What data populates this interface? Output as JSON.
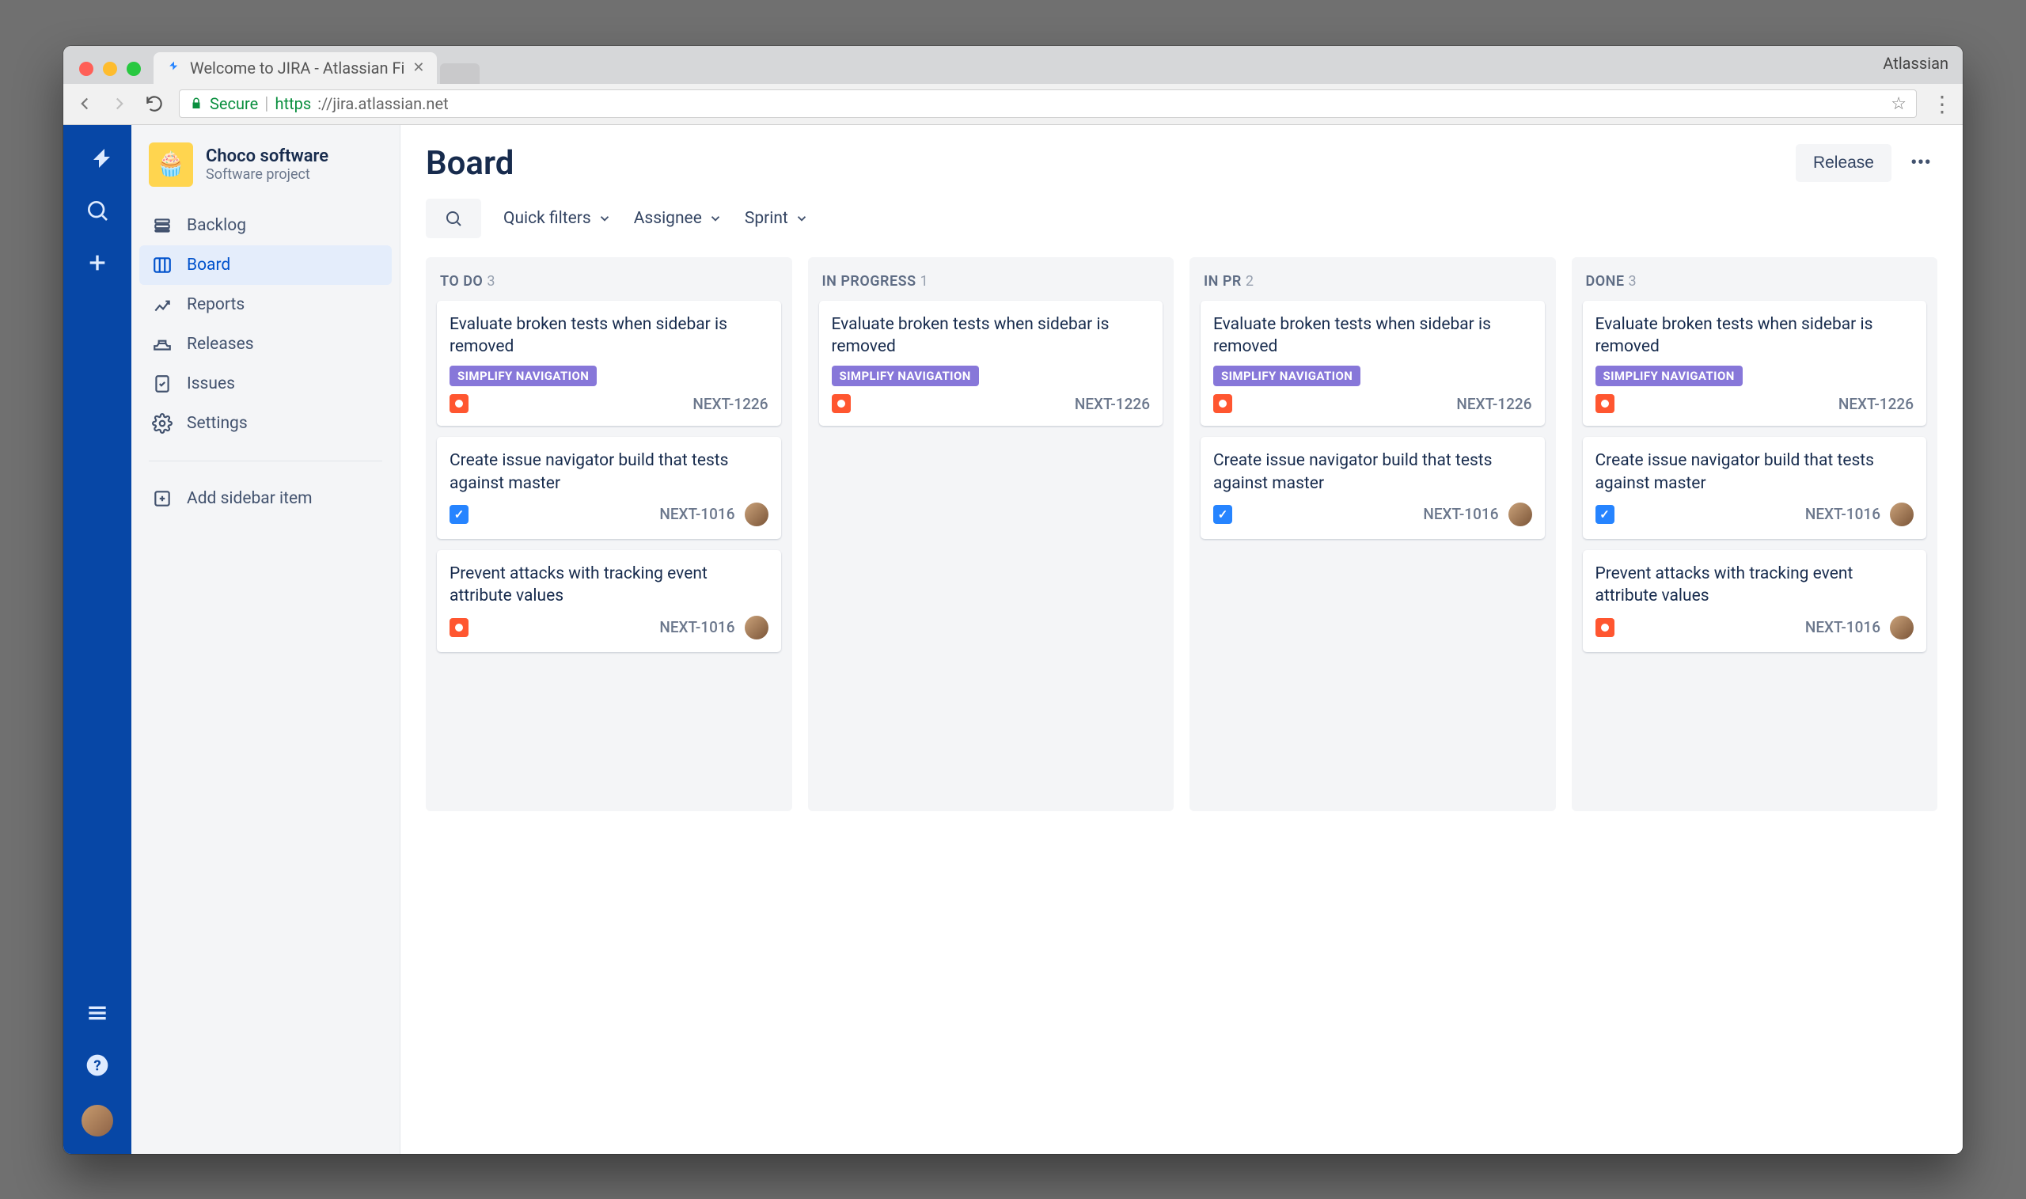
{
  "browser": {
    "tab_title": "Welcome to JIRA - Atlassian Fi",
    "right_label": "Atlassian",
    "secure_label": "Secure",
    "url_https": "https",
    "url_rest": "://jira.atlassian.net"
  },
  "project": {
    "name": "Choco software",
    "subtitle": "Software project"
  },
  "sidebar": {
    "items": [
      {
        "label": "Backlog"
      },
      {
        "label": "Board"
      },
      {
        "label": "Reports"
      },
      {
        "label": "Releases"
      },
      {
        "label": "Issues"
      },
      {
        "label": "Settings"
      }
    ],
    "add_label": "Add sidebar item"
  },
  "header": {
    "title": "Board",
    "release_label": "Release"
  },
  "filters": {
    "quick": "Quick filters",
    "assignee": "Assignee",
    "sprint": "Sprint"
  },
  "epic_label": "SIMPLIFY NAVIGATION",
  "columns": [
    {
      "name": "TO DO",
      "count": "3",
      "cards": [
        {
          "title": "Evaluate broken tests when sidebar is removed",
          "epic": true,
          "type": "bug",
          "key": "NEXT-1226",
          "assignee": false
        },
        {
          "title": "Create issue navigator build that tests against master",
          "epic": false,
          "type": "task",
          "key": "NEXT-1016",
          "assignee": true
        },
        {
          "title": "Prevent attacks with tracking event attribute values",
          "epic": false,
          "type": "bug",
          "key": "NEXT-1016",
          "assignee": true
        }
      ]
    },
    {
      "name": "IN PROGRESS",
      "count": "1",
      "cards": [
        {
          "title": "Evaluate broken tests when sidebar is removed",
          "epic": true,
          "type": "bug",
          "key": "NEXT-1226",
          "assignee": false
        }
      ]
    },
    {
      "name": "IN PR",
      "count": "2",
      "cards": [
        {
          "title": "Evaluate broken tests when sidebar is removed",
          "epic": true,
          "type": "bug",
          "key": "NEXT-1226",
          "assignee": false
        },
        {
          "title": "Create issue navigator build that tests against master",
          "epic": false,
          "type": "task",
          "key": "NEXT-1016",
          "assignee": true
        }
      ]
    },
    {
      "name": "DONE",
      "count": "3",
      "cards": [
        {
          "title": "Evaluate broken tests when sidebar is removed",
          "epic": true,
          "type": "bug",
          "key": "NEXT-1226",
          "assignee": false
        },
        {
          "title": "Create issue navigator build that tests against master",
          "epic": false,
          "type": "task",
          "key": "NEXT-1016",
          "assignee": true
        },
        {
          "title": "Prevent attacks with tracking event attribute values",
          "epic": false,
          "type": "bug",
          "key": "NEXT-1016",
          "assignee": true
        }
      ]
    }
  ]
}
